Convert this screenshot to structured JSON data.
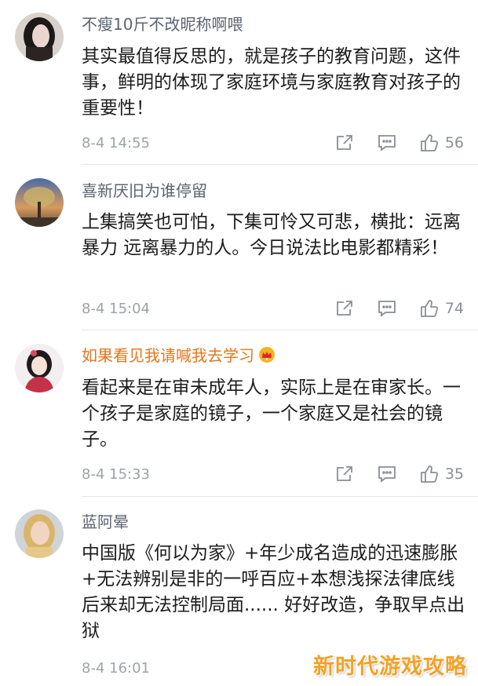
{
  "comments": [
    {
      "username": "不瘦10斤不改昵称啊喂",
      "text": "其实最值得反思的，就是孩子的教育问题，这件事，鲜明的体现了家庭环境与家庭教育对孩子的重要性！",
      "time": "8-4 14:55",
      "likes": "56",
      "vip": false,
      "avatar": "portrait-dark-hair"
    },
    {
      "username": "喜新厌旧为谁停留",
      "text": "上集搞笑也可怕，下集可怜又可悲，横批：远离暴力 远离暴力的人。今日说法比电影都精彩！",
      "time": "8-4 15:04",
      "likes": "74",
      "vip": false,
      "avatar": "tree-sunset"
    },
    {
      "username": "如果看见我请喊我去学习",
      "text": "看起来是在审未成年人，实际上是在审家长。一个孩子是家庭的镜子，一个家庭又是社会的镜子。",
      "time": "8-4 15:33",
      "likes": "35",
      "vip": true,
      "avatar": "cartoon-girl"
    },
    {
      "username": "蓝阿晕",
      "text": "中国版《何以为家》+年少成名造成的迅速膨胀+无法辨别是非的一呼百应+本想浅探法律底线后来却无法控制局面...... 好好改造，争取早点出狱",
      "time": "8-4 16:01",
      "likes": "",
      "vip": false,
      "avatar": "portrait-blonde"
    }
  ],
  "watermark": "新时代游戏攻略",
  "colors": {
    "username": "#5b6470",
    "vip_username": "#e8751a",
    "text": "#1c1c1c",
    "meta": "#9ea3a8",
    "watermark": "#f2a227"
  },
  "icons": {
    "repost": "share-arrow-icon",
    "comment": "comment-bubble-icon",
    "like": "thumbs-up-icon",
    "vip": "crown-icon"
  }
}
